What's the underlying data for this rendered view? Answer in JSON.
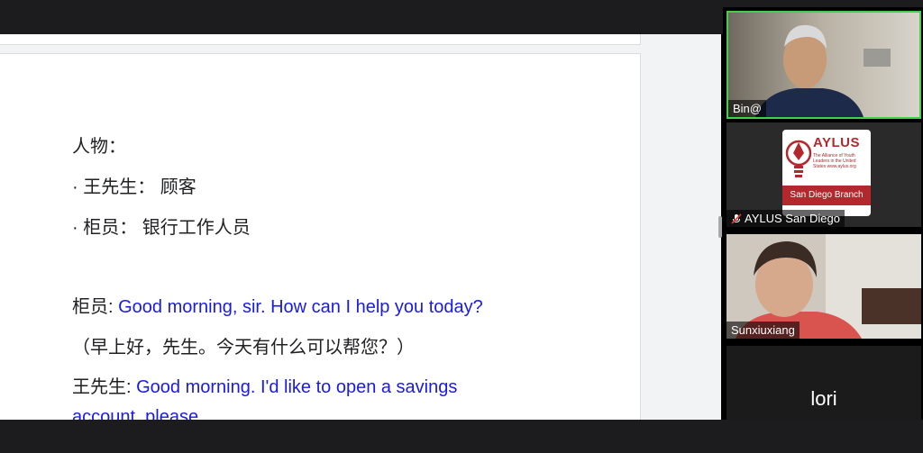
{
  "document": {
    "lines": [
      "人物：",
      "· 王先生：  顾客",
      "· 柜员：  银行工作人员"
    ],
    "dialogue": [
      {
        "speaker": "柜员:",
        "english": " Good morning, sir. How can I help you today?"
      },
      {
        "translation": "（早上好，先生。今天有什么可以帮您？）"
      },
      {
        "speaker": "王先生:",
        "english": " Good morning. I'd like to open a savings"
      },
      {
        "english": "account, please."
      }
    ]
  },
  "participants": [
    {
      "name": "Bin@",
      "active_speaker": true,
      "video": true
    },
    {
      "name": "AYLUS San Diego",
      "muted": true,
      "logo": {
        "title": "AYLUS",
        "subtitle": "The Alliance of Youth Leaders in the United States  www.aylus.org",
        "band": "San Diego Branch"
      }
    },
    {
      "name": "Sunxiuxiang",
      "video": true
    },
    {
      "name": "lori",
      "display_name": "lori",
      "video": false
    }
  ],
  "colors": {
    "english_text": "#1a1ae6",
    "active_border": "#3fd14a",
    "brand_red": "#b3282d"
  }
}
